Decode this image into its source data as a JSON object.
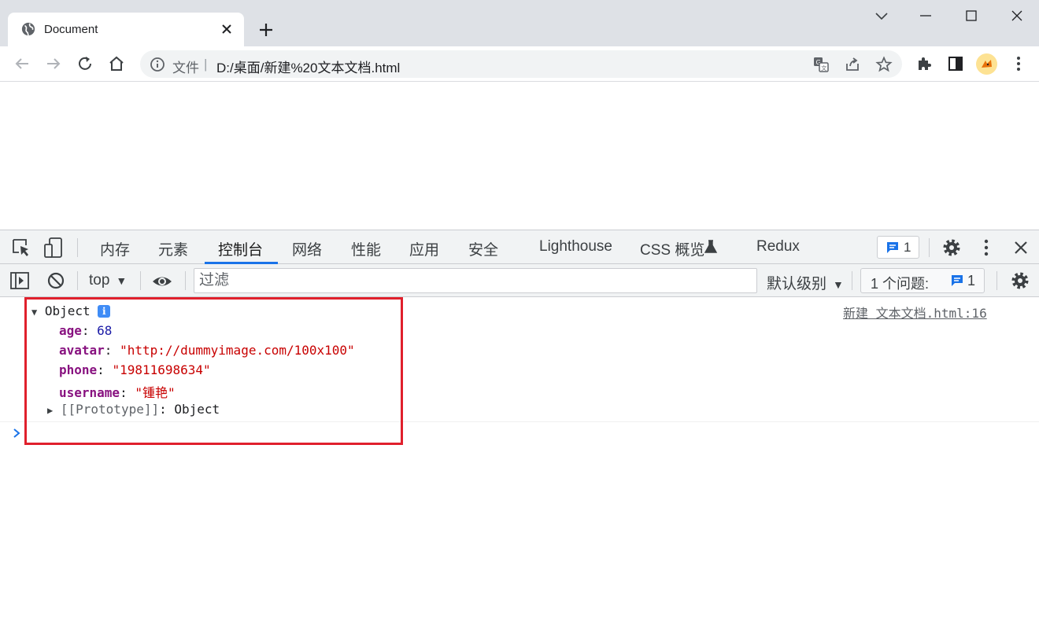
{
  "browser": {
    "tab": {
      "title": "Document",
      "favicon": "globe-icon"
    },
    "omnibox": {
      "scheme_label": "文件",
      "separator": "|",
      "url": "D:/桌面/新建%20文本文档.html"
    }
  },
  "devtools": {
    "tabs": [
      {
        "label": "内存",
        "active": false
      },
      {
        "label": "元素",
        "active": false
      },
      {
        "label": "控制台",
        "active": true
      },
      {
        "label": "网络",
        "active": false
      },
      {
        "label": "性能",
        "active": false
      },
      {
        "label": "应用",
        "active": false
      },
      {
        "label": "安全",
        "active": false
      },
      {
        "label": "Lighthouse",
        "active": false
      },
      {
        "label": "CSS 概览",
        "active": false
      },
      {
        "label": "Redux",
        "active": false
      }
    ],
    "issues_badge_count": "1",
    "console_toolbar": {
      "context": "top",
      "filter_placeholder": "过滤",
      "levels": "默认级别",
      "issues_label": "1 个问题:",
      "issues_count": "1"
    },
    "log": {
      "object_label": "Object",
      "info_badge": "i",
      "source": "新建 文本文档.html:16",
      "properties": [
        {
          "key": "age",
          "value": "68",
          "type": "number"
        },
        {
          "key": "avatar",
          "value": "\"http://dummyimage.com/100x100\"",
          "type": "string"
        },
        {
          "key": "phone",
          "value": "\"19811698634\"",
          "type": "string"
        },
        {
          "key": "username",
          "value": "\"锺艳\"",
          "type": "string"
        }
      ],
      "prototype_key": "[[Prototype]]",
      "prototype_value": "Object"
    }
  },
  "colors": {
    "accent": "#1a73e8",
    "highlight_box": "#e0202c"
  }
}
